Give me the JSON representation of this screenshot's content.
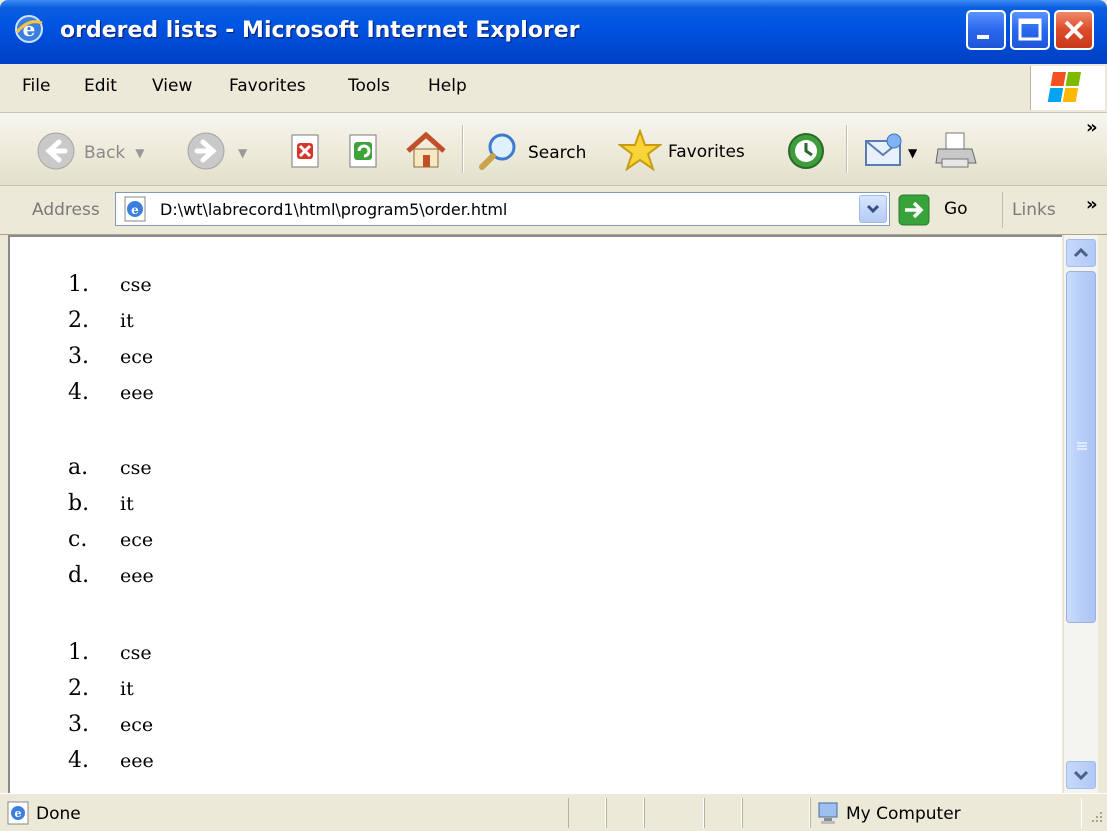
{
  "window": {
    "title": "ordered lists - Microsoft Internet Explorer"
  },
  "menu": {
    "items": [
      "File",
      "Edit",
      "View",
      "Favorites",
      "Tools",
      "Help"
    ]
  },
  "toolbar": {
    "back_label": "Back",
    "search_label": "Search",
    "favorites_label": "Favorites"
  },
  "address": {
    "label": "Address",
    "value": "D:\\wt\\labrecord1\\html\\program5\\order.html",
    "go_label": "Go",
    "links_label": "Links"
  },
  "content": {
    "lists": [
      {
        "markers": [
          "1.",
          "2.",
          "3.",
          "4."
        ],
        "items": [
          "cse",
          "it",
          "ece",
          "eee"
        ]
      },
      {
        "markers": [
          "a.",
          "b.",
          "c.",
          "d."
        ],
        "items": [
          "cse",
          "it",
          "ece",
          "eee"
        ]
      },
      {
        "markers": [
          "1.",
          "2.",
          "3.",
          "4."
        ],
        "items": [
          "cse",
          "it",
          "ece",
          "eee"
        ]
      }
    ]
  },
  "status": {
    "text": "Done",
    "zone": "My Computer"
  }
}
